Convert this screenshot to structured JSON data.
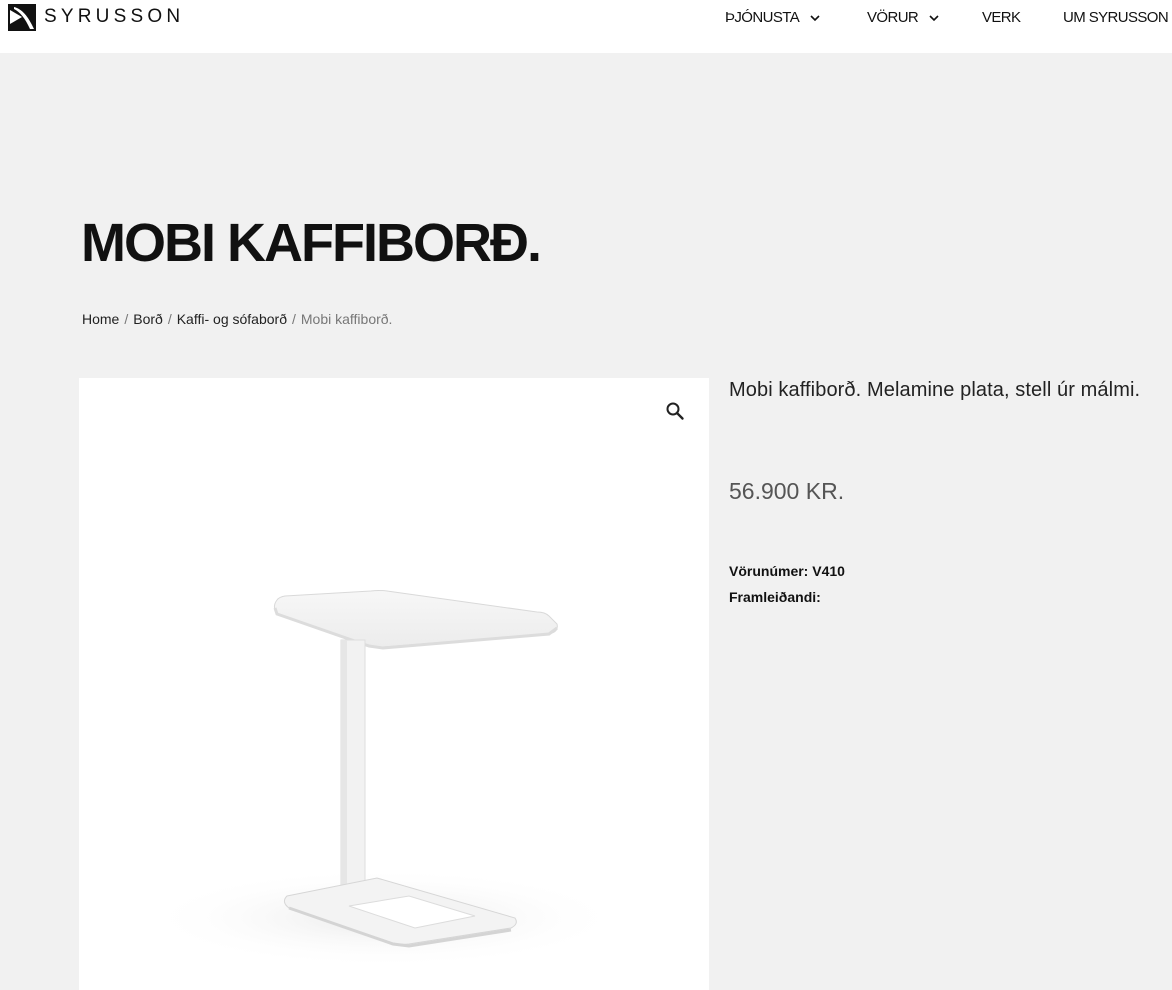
{
  "brand": {
    "name": "SYRUSSON"
  },
  "nav": {
    "items": [
      {
        "label": "ÞJÓNUSTA",
        "has_dropdown": true
      },
      {
        "label": "VÖRUR",
        "has_dropdown": true
      },
      {
        "label": "VERK",
        "has_dropdown": false
      },
      {
        "label": "UM SYRUSSON",
        "has_dropdown": false
      }
    ]
  },
  "product": {
    "title": "MOBI KAFFIBORÐ.",
    "short_description": "Mobi kaffiborð. Melamine plata, stell úr málmi.",
    "price": "56.900 KR.",
    "sku_label": "Vörunúmer:",
    "sku_value": "V410",
    "manufacturer_label": "Framleiðandi:",
    "manufacturer_value": ""
  },
  "breadcrumb": {
    "items": [
      {
        "label": "Home"
      },
      {
        "label": "Borð"
      },
      {
        "label": "Kaffi- og sófaborð"
      }
    ],
    "current": "Mobi kaffiborð.",
    "separator": "/"
  },
  "gallery": {
    "zoom_icon": "magnifier-icon"
  },
  "colors": {
    "page_bg": "#f1f1f1",
    "header_bg": "#ffffff",
    "text": "#111111",
    "muted": "#777777",
    "price": "#555555"
  }
}
